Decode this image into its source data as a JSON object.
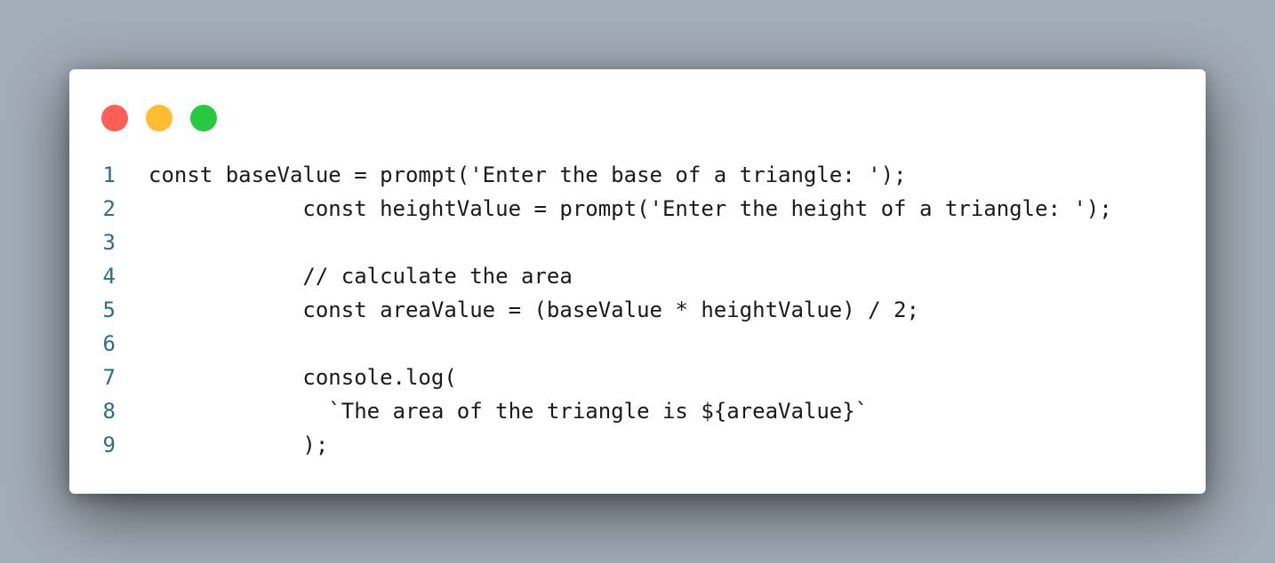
{
  "colors": {
    "close": "#ff5f57",
    "minimize": "#febc2e",
    "maximize": "#28c840",
    "line_number": "#2b6e86",
    "code_text": "#1a1a1a",
    "background": "#a3adb8",
    "window": "#ffffff"
  },
  "code": {
    "lines": [
      {
        "num": "1",
        "text": "const baseValue = prompt('Enter the base of a triangle: ');"
      },
      {
        "num": "2",
        "text": "            const heightValue = prompt('Enter the height of a triangle: ');"
      },
      {
        "num": "3",
        "text": ""
      },
      {
        "num": "4",
        "text": "            // calculate the area"
      },
      {
        "num": "5",
        "text": "            const areaValue = (baseValue * heightValue) / 2;"
      },
      {
        "num": "6",
        "text": ""
      },
      {
        "num": "7",
        "text": "            console.log("
      },
      {
        "num": "8",
        "text": "              `The area of the triangle is ${areaValue}`"
      },
      {
        "num": "9",
        "text": "            );"
      }
    ]
  }
}
